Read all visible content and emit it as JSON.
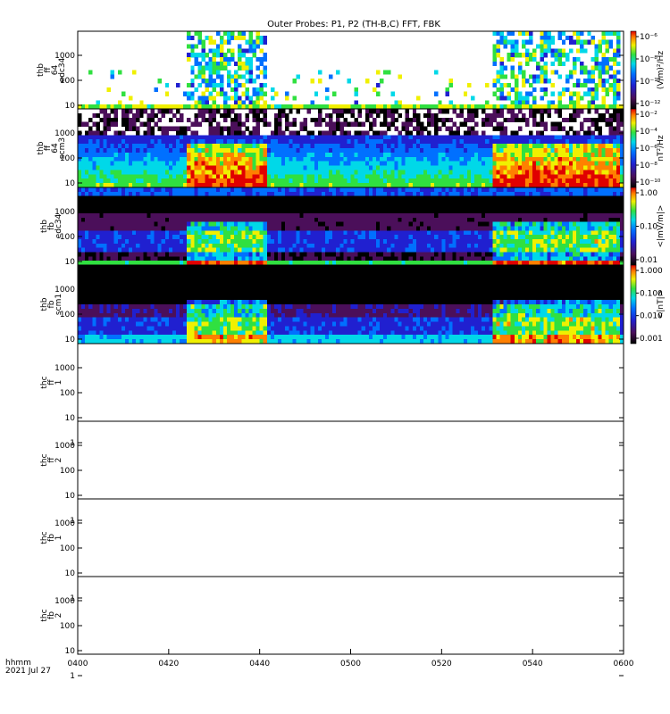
{
  "title": "Outer Probes: P1, P2 (TH-B,C) FFT, FBK",
  "footer": {
    "axis_label": "hhmm",
    "date": "2021 Jul 27"
  },
  "x_ticks": [
    "0400",
    "0420",
    "0440",
    "0500",
    "0520",
    "0540",
    "0600"
  ],
  "colorbars": [
    {
      "unit": "(V/m)²/Hz",
      "ticks": [
        "10⁻⁶",
        "10⁻⁸",
        "10⁻¹⁰",
        "10⁻¹²"
      ]
    },
    {
      "unit": "nT²/Hz",
      "ticks": [
        "10⁻²",
        "10⁻⁴",
        "10⁻⁶",
        "10⁻⁸",
        "10⁻¹⁰"
      ]
    },
    {
      "unit": "<|mV/m|>",
      "ticks": [
        "1.00",
        "0.10",
        "0.01"
      ]
    },
    {
      "unit": "<|nT|>",
      "ticks": [
        "1.000",
        "0.100",
        "0.010",
        "0.001"
      ]
    }
  ],
  "panels": [
    {
      "label": [
        "thb",
        "ff",
        "64",
        "edc34"
      ],
      "y_ticks": [
        "1000",
        "100",
        "10"
      ],
      "style": "fft_e"
    },
    {
      "label": [
        "thb",
        "ff",
        "64",
        "scm3"
      ],
      "y_ticks": [
        "1000",
        "100",
        "10"
      ],
      "style": "fft_b"
    },
    {
      "label": [
        "thb",
        "fb",
        "edc34"
      ],
      "y_ticks": [
        "1000",
        "100",
        "10"
      ],
      "style": "fbk_e"
    },
    {
      "label": [
        "thb",
        "fb",
        "scm1"
      ],
      "y_ticks": [
        "1000",
        "100",
        "10"
      ],
      "style": "fbk_b"
    },
    {
      "label": [
        "thc",
        "ff",
        "1"
      ],
      "y_ticks": [
        "1000",
        "100",
        "10",
        "1"
      ],
      "style": "empty"
    },
    {
      "label": [
        "thc",
        "ff",
        "2"
      ],
      "y_ticks": [
        "1000",
        "100",
        "10",
        "1"
      ],
      "style": "empty"
    },
    {
      "label": [
        "thc",
        "fb",
        "1"
      ],
      "y_ticks": [
        "1000",
        "100",
        "10",
        "1"
      ],
      "style": "empty"
    },
    {
      "label": [
        "thc",
        "fb",
        "2"
      ],
      "y_ticks": [
        "1000",
        "100",
        "10",
        "1"
      ],
      "style": "empty"
    }
  ],
  "chart_data": {
    "type": "heatmap",
    "title": "Outer Probes: P1, P2 (TH-B,C) FFT, FBK",
    "x_axis": {
      "label": "hhmm",
      "range": [
        "0400",
        "0600"
      ],
      "ticks": [
        "0400",
        "0420",
        "0440",
        "0500",
        "0520",
        "0540",
        "0600"
      ]
    },
    "y_scale": "log",
    "series": [
      {
        "name": "thb ff 64 edc34",
        "unit": "(V/m)²/Hz",
        "freq_range_hz": [
          8,
          8000
        ],
        "color_range": [
          "1e-13",
          "1e-5"
        ]
      },
      {
        "name": "thb ff 64 scm3",
        "unit": "nT²/Hz",
        "freq_range_hz": [
          8,
          8000
        ],
        "color_range": [
          "1e-11",
          "1e-1"
        ]
      },
      {
        "name": "thb fb edc34",
        "unit": "<|mV/m|>",
        "freq_range_hz": [
          2,
          2000
        ],
        "color_range": [
          0.003,
          3.0
        ]
      },
      {
        "name": "thb fb scm1",
        "unit": "<|nT|>",
        "freq_range_hz": [
          2,
          2000
        ],
        "color_range": [
          0.001,
          1.0
        ]
      },
      {
        "name": "thc ff 1",
        "values": []
      },
      {
        "name": "thc ff 2",
        "values": []
      },
      {
        "name": "thc fb 1",
        "values": []
      },
      {
        "name": "thc fb 2",
        "values": []
      }
    ],
    "colormap": [
      "black",
      "purple",
      "blue",
      "cyan",
      "green",
      "yellow",
      "red"
    ]
  }
}
